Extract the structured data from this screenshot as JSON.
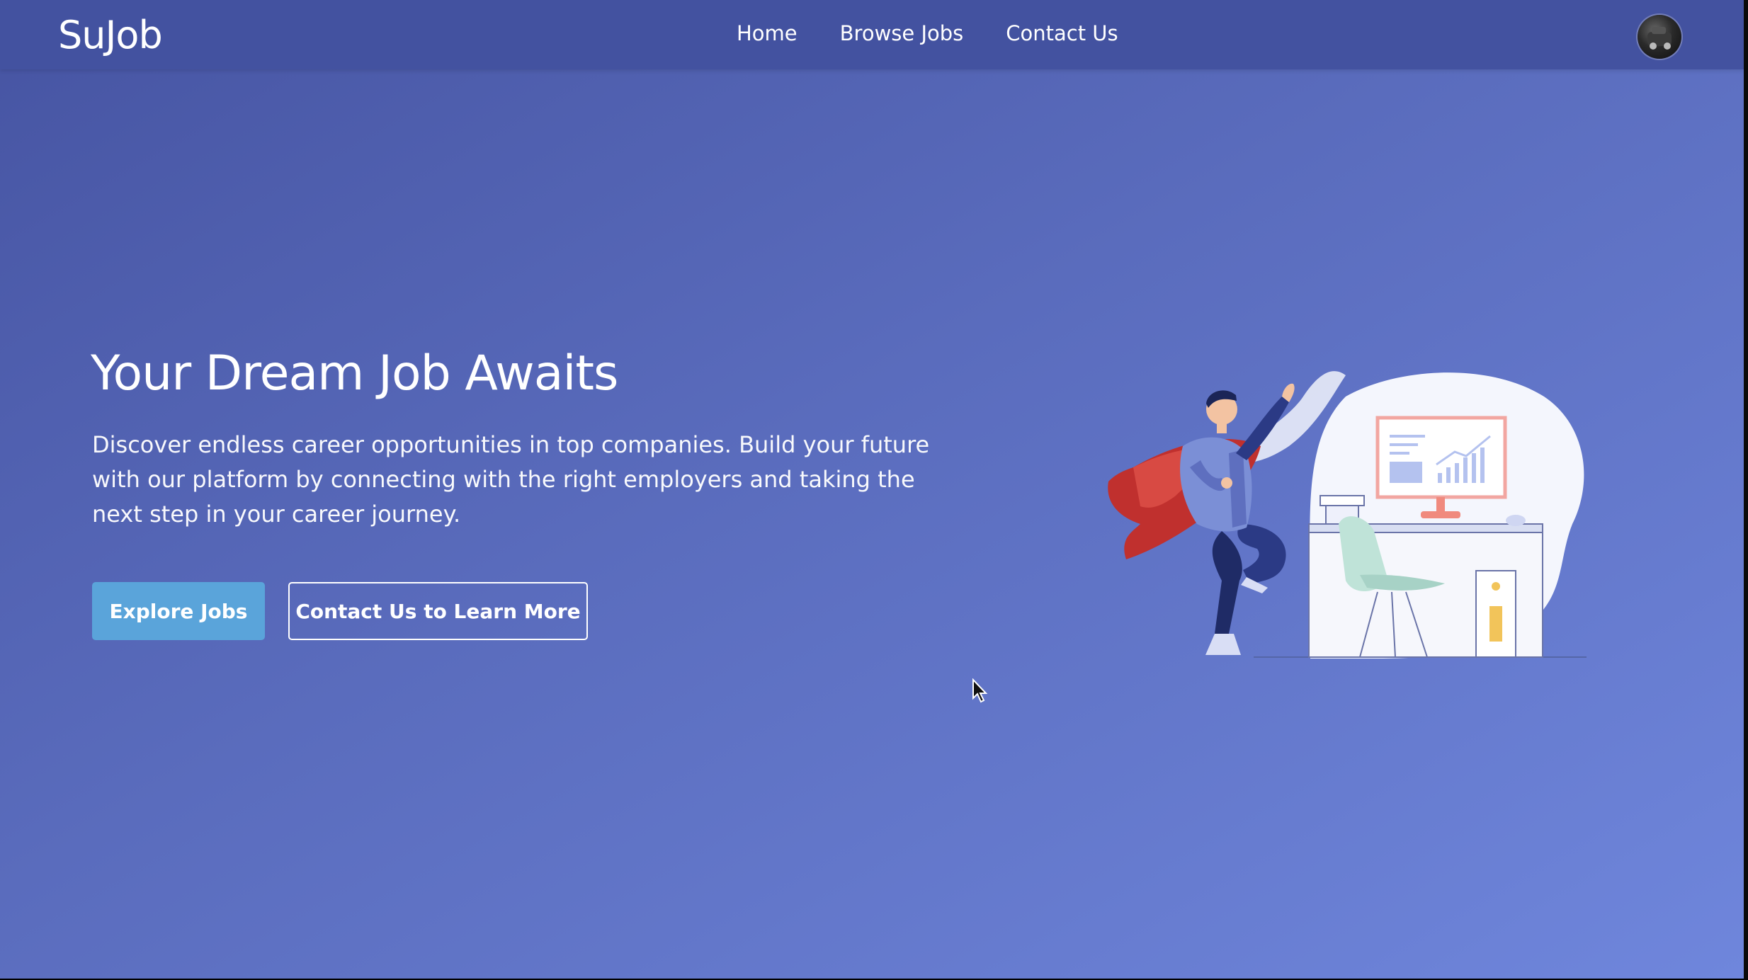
{
  "app": {
    "logo": "SuJob"
  },
  "nav": {
    "items": [
      "Home",
      "Browse Jobs",
      "Contact Us"
    ]
  },
  "user": {
    "avatar_icon": "user-avatar-icon"
  },
  "hero": {
    "title": "Your Dream Job Awaits",
    "description": "Discover endless career opportunities in top companies. Build your future with our platform by connecting with the right employers and taking the next step in your career journey.",
    "primary_button": "Explore Jobs",
    "secondary_button": "Contact Us to Learn More"
  },
  "colors": {
    "navbar": "#4352a0",
    "background_start": "#4654a2",
    "background_end": "#6f86dc",
    "primary_button": "#5aa4da"
  }
}
